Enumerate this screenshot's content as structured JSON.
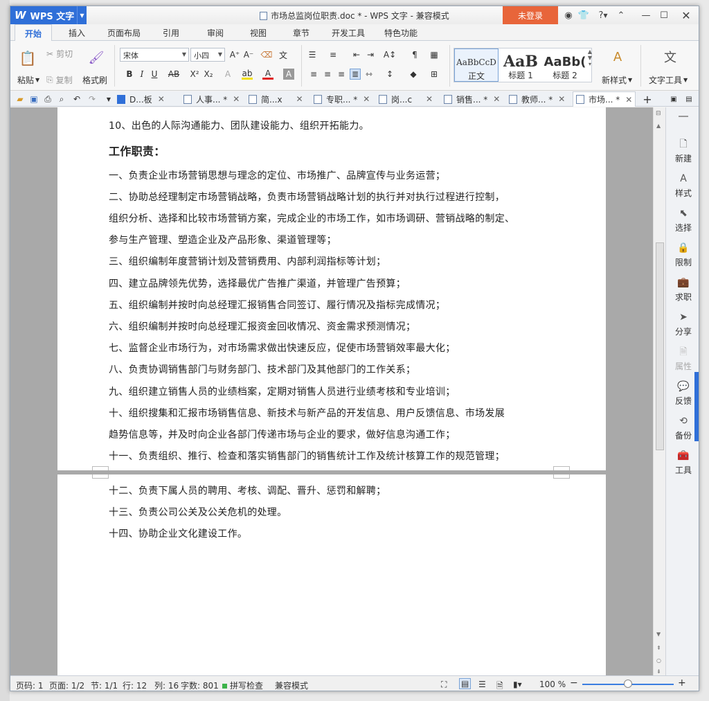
{
  "app": {
    "name": "WPS 文字",
    "logo": "W"
  },
  "titlebar": {
    "title": "市场总监岗位职责.doc * - WPS 文字 - 兼容模式",
    "login": "未登录",
    "help": "?"
  },
  "menu": {
    "tabs": [
      "开始",
      "插入",
      "页面布局",
      "引用",
      "审阅",
      "视图",
      "章节",
      "开发工具",
      "特色功能"
    ]
  },
  "ribbon": {
    "paste": "粘贴",
    "cut": "剪切",
    "copy": "复制",
    "format_painter": "格式刷",
    "font_name": "宋体",
    "font_size": "小四",
    "styles": [
      {
        "preview": "AaBbCcD",
        "label": "正文"
      },
      {
        "preview": "AaB",
        "label": "标题 1"
      },
      {
        "preview": "AaBb(",
        "label": "标题 2"
      }
    ],
    "new_style": "新样式",
    "text_tools": "文字工具"
  },
  "doc_tabs": [
    "D...板",
    "人事... *",
    "简...x",
    "专职... *",
    "岗...c",
    "销售... *",
    "教师... *",
    "市场... *"
  ],
  "document": {
    "page1": [
      {
        "text": "10、出色的人际沟通能力、团队建设能力、组织开拓能力。",
        "heading": false
      },
      {
        "text": "工作职责：",
        "heading": true
      },
      {
        "text": "一、负责企业市场营销思想与理念的定位、市场推广、品牌宣传与业务运营；",
        "heading": false
      },
      {
        "text": "二、协助总经理制定市场营销战略，负责市场营销战略计划的执行并对执行过程进行控制，",
        "heading": false
      },
      {
        "text": "组织分析、选择和比较市场营销方案，完成企业的市场工作，如市场调研、营销战略的制定、",
        "heading": false
      },
      {
        "text": "参与生产管理、塑造企业及产品形象、渠道管理等；",
        "heading": false
      },
      {
        "text": "三、组织编制年度营销计划及营销费用、内部利润指标等计划；",
        "heading": false
      },
      {
        "text": "四、建立品牌领先优势，选择最优广告推广渠道，并管理广告预算；",
        "heading": false
      },
      {
        "text": "五、组织编制并按时向总经理汇报销售合同签订、履行情况及指标完成情况；",
        "heading": false
      },
      {
        "text": "六、组织编制并按时向总经理汇报资金回收情况、资金需求预测情况；",
        "heading": false
      },
      {
        "text": "七、监督企业市场行为，对市场需求做出快速反应，促使市场营销效率最大化；",
        "heading": false
      },
      {
        "text": "八、负责协调销售部门与财务部门、技术部门及其他部门的工作关系；",
        "heading": false
      },
      {
        "text": "九、组织建立销售人员的业绩档案，定期对销售人员进行业绩考核和专业培训；",
        "heading": false
      },
      {
        "text": "十、组织搜集和汇报市场销售信息、新技术与新产品的开发信息、用户反馈信息、市场发展",
        "heading": false
      },
      {
        "text": "趋势信息等，并及时向企业各部门传递市场与企业的要求，做好信息沟通工作；",
        "heading": false
      },
      {
        "text": "十一、负责组织、推行、检查和落实销售部门的销售统计工作及统计核算工作的规范管理；",
        "heading": false
      }
    ],
    "page2": [
      "十二、负责下属人员的聘用、考核、调配、晋升、惩罚和解聘；",
      "十三、负责公司公关及公关危机的处理。",
      "十四、协助企业文化建设工作。"
    ]
  },
  "sidebar": [
    "新建",
    "样式",
    "选择",
    "限制",
    "求职",
    "分享",
    "属性",
    "反馈",
    "备份",
    "工具"
  ],
  "status": {
    "page_code": "页码: 1",
    "page": "页面: 1/2",
    "section": "节: 1/1",
    "row": "行: 12",
    "col": "列: 16",
    "words": "字数: 801",
    "spell": "拼写检查",
    "mode": "兼容模式",
    "zoom": "100 %"
  },
  "colors": {
    "accent": "#2f6fd8",
    "login": "#e8653a"
  }
}
